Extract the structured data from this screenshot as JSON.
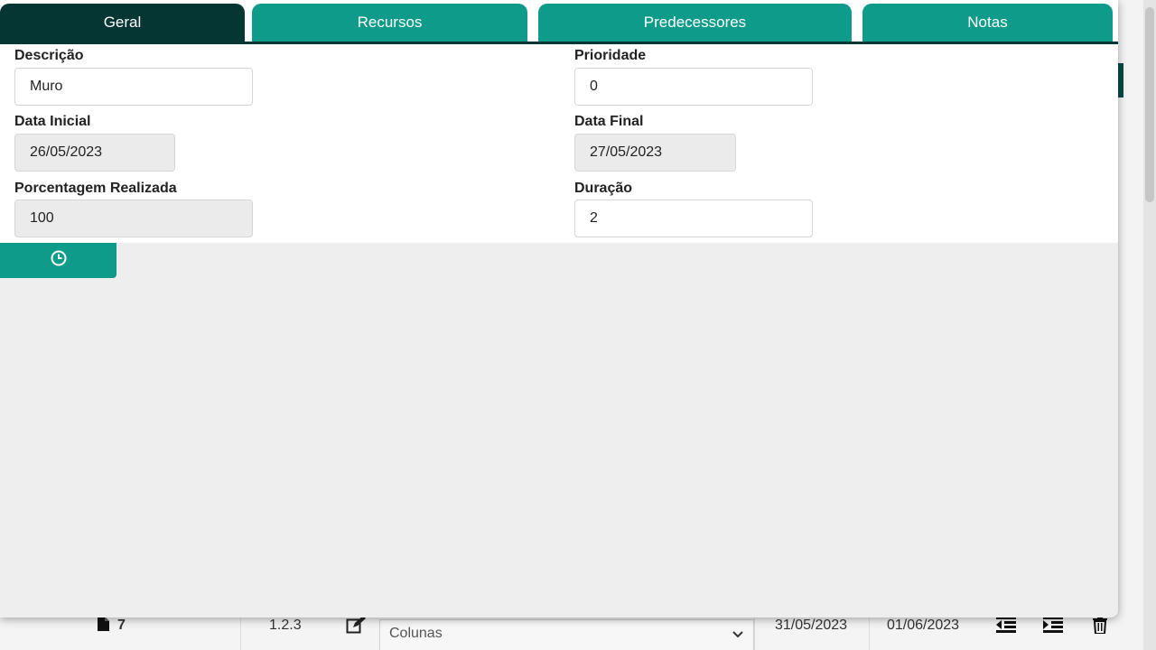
{
  "tabs": [
    {
      "label": "Geral",
      "active": true
    },
    {
      "label": "Recursos",
      "active": false
    },
    {
      "label": "Predecessores",
      "active": false
    },
    {
      "label": "Notas",
      "active": false
    }
  ],
  "form": {
    "descricao": {
      "label": "Descrição",
      "value": "Muro"
    },
    "prioridade": {
      "label": "Prioridade",
      "value": "0"
    },
    "data_inicial": {
      "label": "Data Inicial",
      "value": "26/05/2023"
    },
    "data_final": {
      "label": "Data Final",
      "value": "27/05/2023"
    },
    "porcentagem": {
      "label": "Porcentagem Realizada",
      "value": "100"
    },
    "duracao": {
      "label": "Duração",
      "value": "2"
    }
  },
  "action_button": {
    "icon": "clock-icon"
  },
  "background_row": {
    "id": "7",
    "wbs": "1.2.3",
    "select_value": "Colunas",
    "start": "31/05/2023",
    "end": "01/06/2023",
    "icons": [
      "file-icon",
      "edit-icon",
      "chevron-down-icon",
      "outdent-icon",
      "indent-icon",
      "trash-icon"
    ]
  },
  "colors": {
    "tab_active": "#063634",
    "tab_inactive": "#0e9b8a",
    "accent": "#0e9b8a"
  }
}
